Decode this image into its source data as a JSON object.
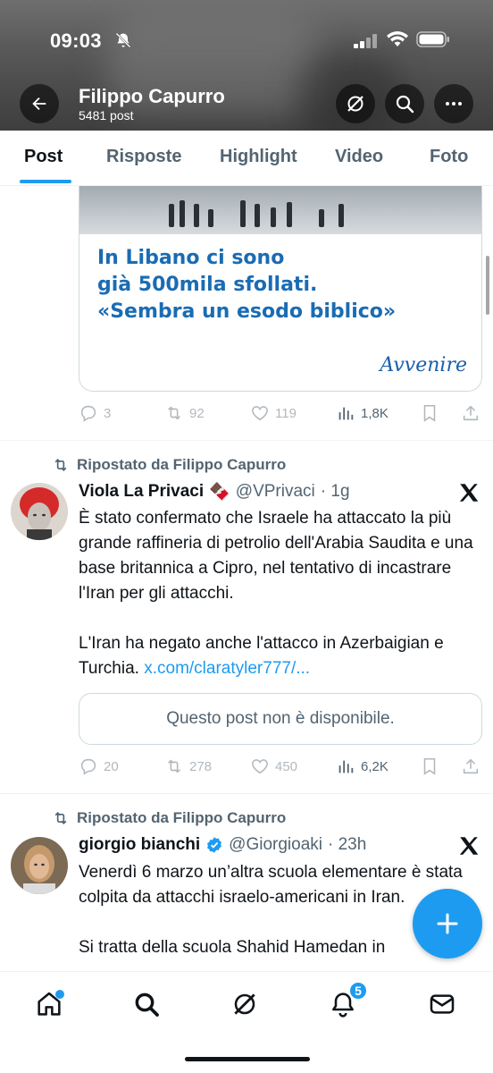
{
  "status_bar": {
    "time": "09:03"
  },
  "header": {
    "profile_name": "Filippo Capurro",
    "post_count": "5481 post"
  },
  "tabs": [
    {
      "label": "Post",
      "active": true
    },
    {
      "label": "Risposte",
      "active": false
    },
    {
      "label": "Highlight",
      "active": false
    },
    {
      "label": "Video",
      "active": false
    },
    {
      "label": "Foto",
      "active": false
    }
  ],
  "feed": {
    "first_tweet": {
      "media_text_lines": [
        "In Libano ci sono",
        "già 500mila sfollati.",
        "«Sembra un esodo biblico»"
      ],
      "media_logo": "Avvenire",
      "replies": "3",
      "reposts": "92",
      "likes": "119",
      "views": "1,8K"
    },
    "tweets": [
      {
        "repost_label": "Ripostato da Filippo Capurro",
        "name": "Viola La Privaci",
        "emoji": "🍫",
        "handle": "@VPrivaci",
        "time": "· 1g",
        "text_paragraph_1": "È stato confermato che Israele ha attaccato la più grande raffineria di petrolio dell'Arabia Saudita e una base britannica a Cipro, nel tentativo di incastrare l'Iran per gli attacchi.",
        "text_paragraph_2": "L'Iran ha negato anche l'attacco in Azerbaigian e Turchia.",
        "link": "x.com/claratyler777/...",
        "quote_unavailable": "Questo post non è disponibile.",
        "replies": "20",
        "reposts": "278",
        "likes": "450",
        "views": "6,2K"
      },
      {
        "repost_label": "Ripostato da Filippo Capurro",
        "name": "giorgio bianchi",
        "handle": "@Giorgioaki",
        "time": "· 23h",
        "verified": true,
        "text_paragraph_1": "Venerdì 6 marzo un’altra scuola elementare  è stata colpita da attacchi israelo-americani in Iran.",
        "text_paragraph_2": "Si tratta della scuola Shahid Hamedan in"
      }
    ]
  },
  "bottom_nav": {
    "items": [
      "home-icon",
      "search-icon",
      "grok-icon",
      "notifications-icon",
      "messages-icon"
    ],
    "notifications_badge": "5"
  },
  "colors": {
    "accent": "#1d9bf0",
    "text": "#0f1419",
    "secondary": "#536471"
  }
}
